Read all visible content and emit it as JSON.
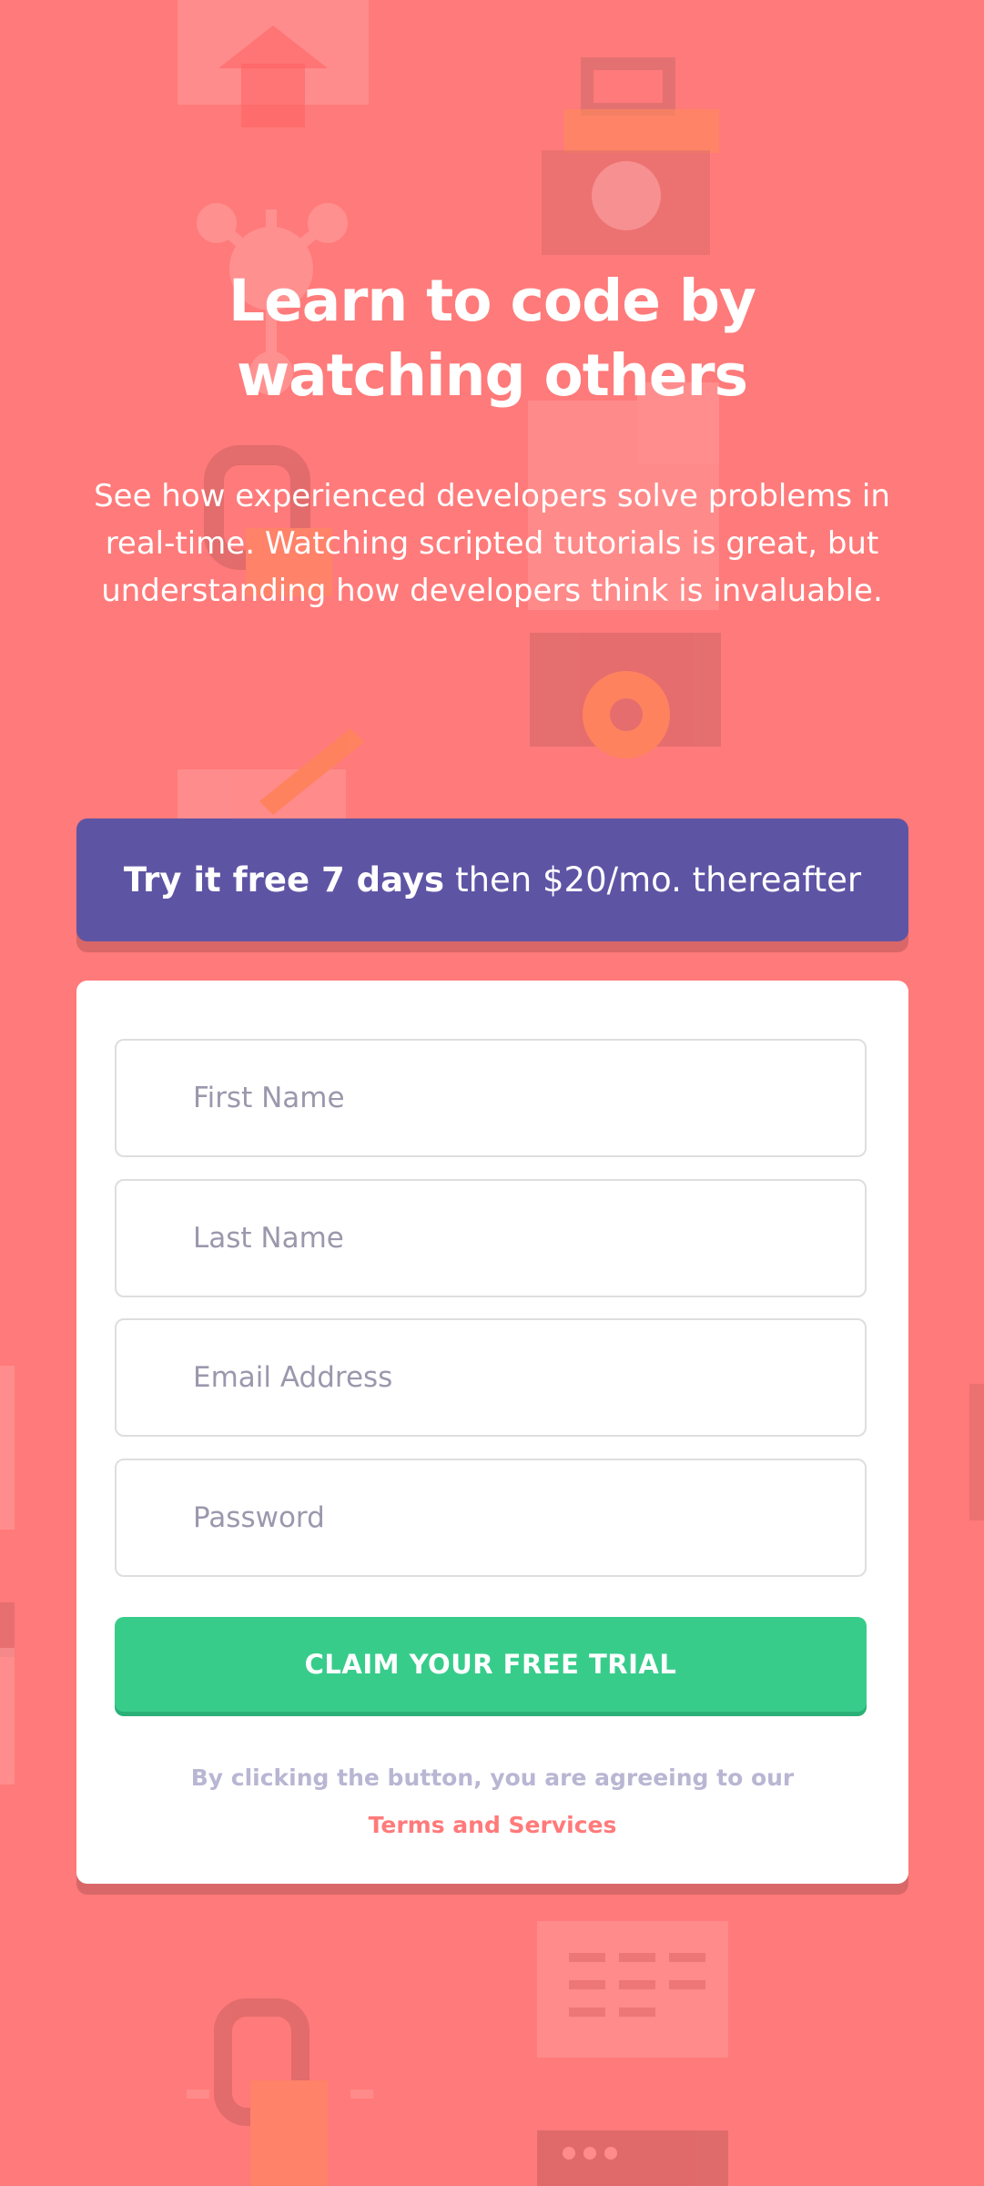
{
  "colors": {
    "background": "#ff7a7a",
    "offer_banner": "#5e54a4",
    "submit_button": "#38cc8b",
    "card": "#ffffff",
    "terms_link": "#ff7a7a",
    "placeholder": "#9b98ad"
  },
  "hero": {
    "title": "Learn to code by watching others",
    "text": "See how experienced developers solve problems in real-time. Watching scripted tutorials is great, but understanding how developers think is invaluable."
  },
  "offer": {
    "bold": "Try it free 7 days",
    "rest": "then $20/mo. thereafter"
  },
  "form": {
    "first_name_placeholder": "First Name",
    "last_name_placeholder": "Last Name",
    "email_placeholder": "Email Address",
    "password_placeholder": "Password",
    "submit_label": "CLAIM YOUR FREE TRIAL",
    "terms_text": "By clicking the button, you are agreeing to our",
    "terms_link": "Terms and Services"
  },
  "background_icons": [
    "house-icon",
    "toolbox-icon",
    "network-icon",
    "pencil-icon",
    "gear-icon",
    "chain-link-icon",
    "calendar-icon",
    "browser-window-icon"
  ]
}
